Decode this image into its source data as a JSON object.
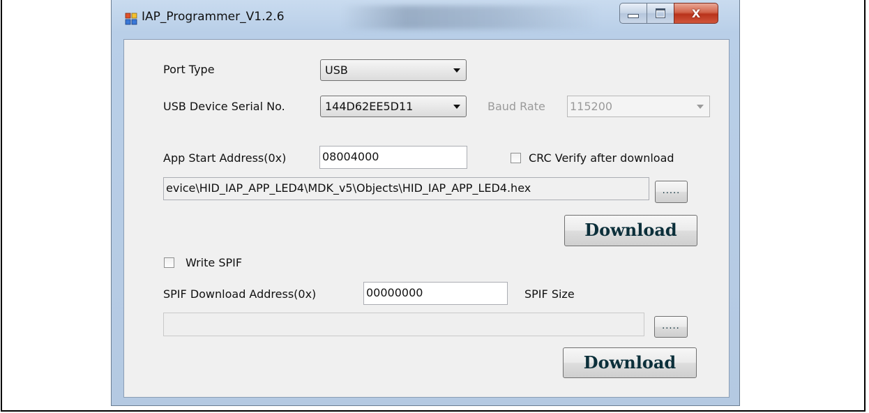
{
  "window": {
    "title": "IAP_Programmer_V1.2.6",
    "controls": {
      "minimize": "minimize-icon",
      "maximize": "maximize-icon",
      "close_label": "X"
    }
  },
  "form": {
    "port_type": {
      "label": "Port Type",
      "value": "USB"
    },
    "usb_serial": {
      "label": "USB Device Serial No.",
      "value": "144D62EE5D11"
    },
    "baud_rate": {
      "label": "Baud Rate",
      "value": "115200",
      "enabled": false
    },
    "app_start": {
      "label": "App Start Address(0x)",
      "value": "08004000"
    },
    "crc_verify": {
      "label": "CRC Verify after download",
      "checked": false
    },
    "app_file": {
      "value": "evice\\HID_IAP_APP_LED4\\MDK_v5\\Objects\\HID_IAP_APP_LED4.hex",
      "browse_label": "....."
    },
    "app_download_label": "Download",
    "write_spif": {
      "label": "Write SPIF",
      "checked": false
    },
    "spif_address": {
      "label": "SPIF Download Address(0x)",
      "value": "00000000"
    },
    "spif_size": {
      "label": "SPIF Size"
    },
    "spif_file": {
      "value": "",
      "browse_label": "....."
    },
    "spif_download_label": "Download"
  },
  "colors": {
    "title_bar": "#b9cfe8",
    "client_bg": "#f0f0f0",
    "close_button": "#c8452b",
    "download_text": "#0b2f3a"
  }
}
